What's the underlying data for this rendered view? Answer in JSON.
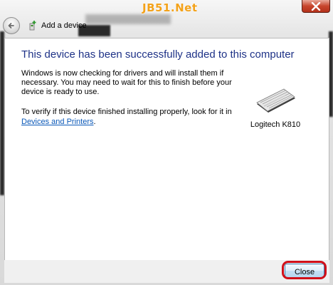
{
  "watermark": {
    "text": "JB51.Net"
  },
  "window": {
    "title": "Add a device"
  },
  "main": {
    "heading": "This device has been successfully added to this computer",
    "paragraph1": "Windows is now checking for drivers and will install them if necessary. You may need to wait for this to finish before your device is ready to use.",
    "paragraph2": "To verify if this device finished installing properly, look for it in",
    "link": "Devices and Printers",
    "link_suffix": "."
  },
  "device": {
    "name": "Logitech K810",
    "icon": "keyboard-icon"
  },
  "footer": {
    "close_label": "Close"
  },
  "colors": {
    "heading": "#1e3287",
    "link": "#0a58b8",
    "highlight": "#d0101a",
    "close_x": "#c7452c"
  }
}
